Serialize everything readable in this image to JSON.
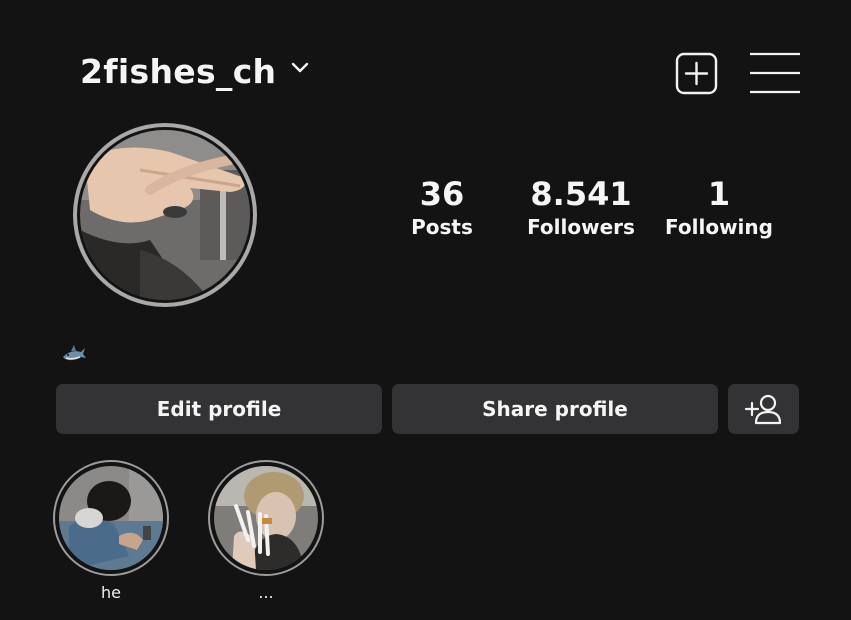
{
  "header": {
    "username": "2fishes_ch",
    "icons": [
      "chevron-down-icon",
      "new-post-icon",
      "menu-icon"
    ]
  },
  "profile": {
    "avatar_icon": "avatar",
    "bio_emoji": "🦈",
    "stats": [
      {
        "value": "36",
        "label": "Posts"
      },
      {
        "value": "8.541",
        "label": "Followers"
      },
      {
        "value": "1",
        "label": "Following"
      }
    ]
  },
  "actions": {
    "edit_label": "Edit profile",
    "share_label": "Share profile",
    "add_person_icon": "add-person-icon"
  },
  "highlights": [
    {
      "label": "he"
    },
    {
      "label": "..."
    }
  ],
  "colors": {
    "background": "#141314",
    "button": "#333234",
    "text": "#f5f5f5",
    "ring": "#a9a9a9"
  }
}
